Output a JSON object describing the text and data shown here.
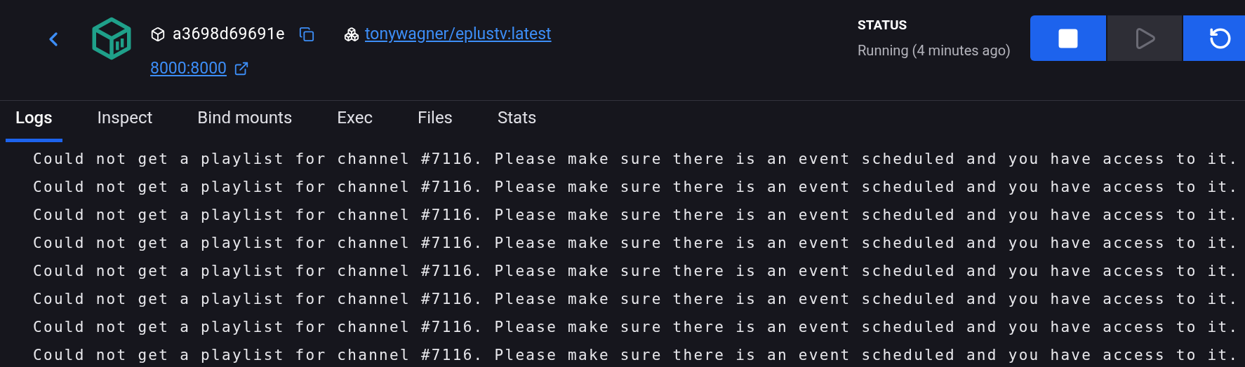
{
  "header": {
    "container_id": "a3698d69691e",
    "image": "tonywagner/eplustv:latest",
    "port": "8000:8000"
  },
  "status": {
    "label": "STATUS",
    "value": "Running (4 minutes ago)"
  },
  "actions": [
    {
      "kind": "stop",
      "disabled": false
    },
    {
      "kind": "start",
      "disabled": true
    },
    {
      "kind": "restart",
      "disabled": false
    }
  ],
  "tabs": [
    {
      "label": "Logs",
      "selected": true
    },
    {
      "label": "Inspect",
      "selected": false
    },
    {
      "label": "Bind mounts",
      "selected": false
    },
    {
      "label": "Exec",
      "selected": false
    },
    {
      "label": "Files",
      "selected": false
    },
    {
      "label": "Stats",
      "selected": false
    }
  ],
  "logs": [
    "Could not get a playlist for channel #7116. Please make sure there is an event scheduled and you have access to it.",
    "Could not get a playlist for channel #7116. Please make sure there is an event scheduled and you have access to it.",
    "Could not get a playlist for channel #7116. Please make sure there is an event scheduled and you have access to it.",
    "Could not get a playlist for channel #7116. Please make sure there is an event scheduled and you have access to it.",
    "Could not get a playlist for channel #7116. Please make sure there is an event scheduled and you have access to it.",
    "Could not get a playlist for channel #7116. Please make sure there is an event scheduled and you have access to it.",
    "Could not get a playlist for channel #7116. Please make sure there is an event scheduled and you have access to it.",
    "Could not get a playlist for channel #7116. Please make sure there is an event scheduled and you have access to it."
  ]
}
